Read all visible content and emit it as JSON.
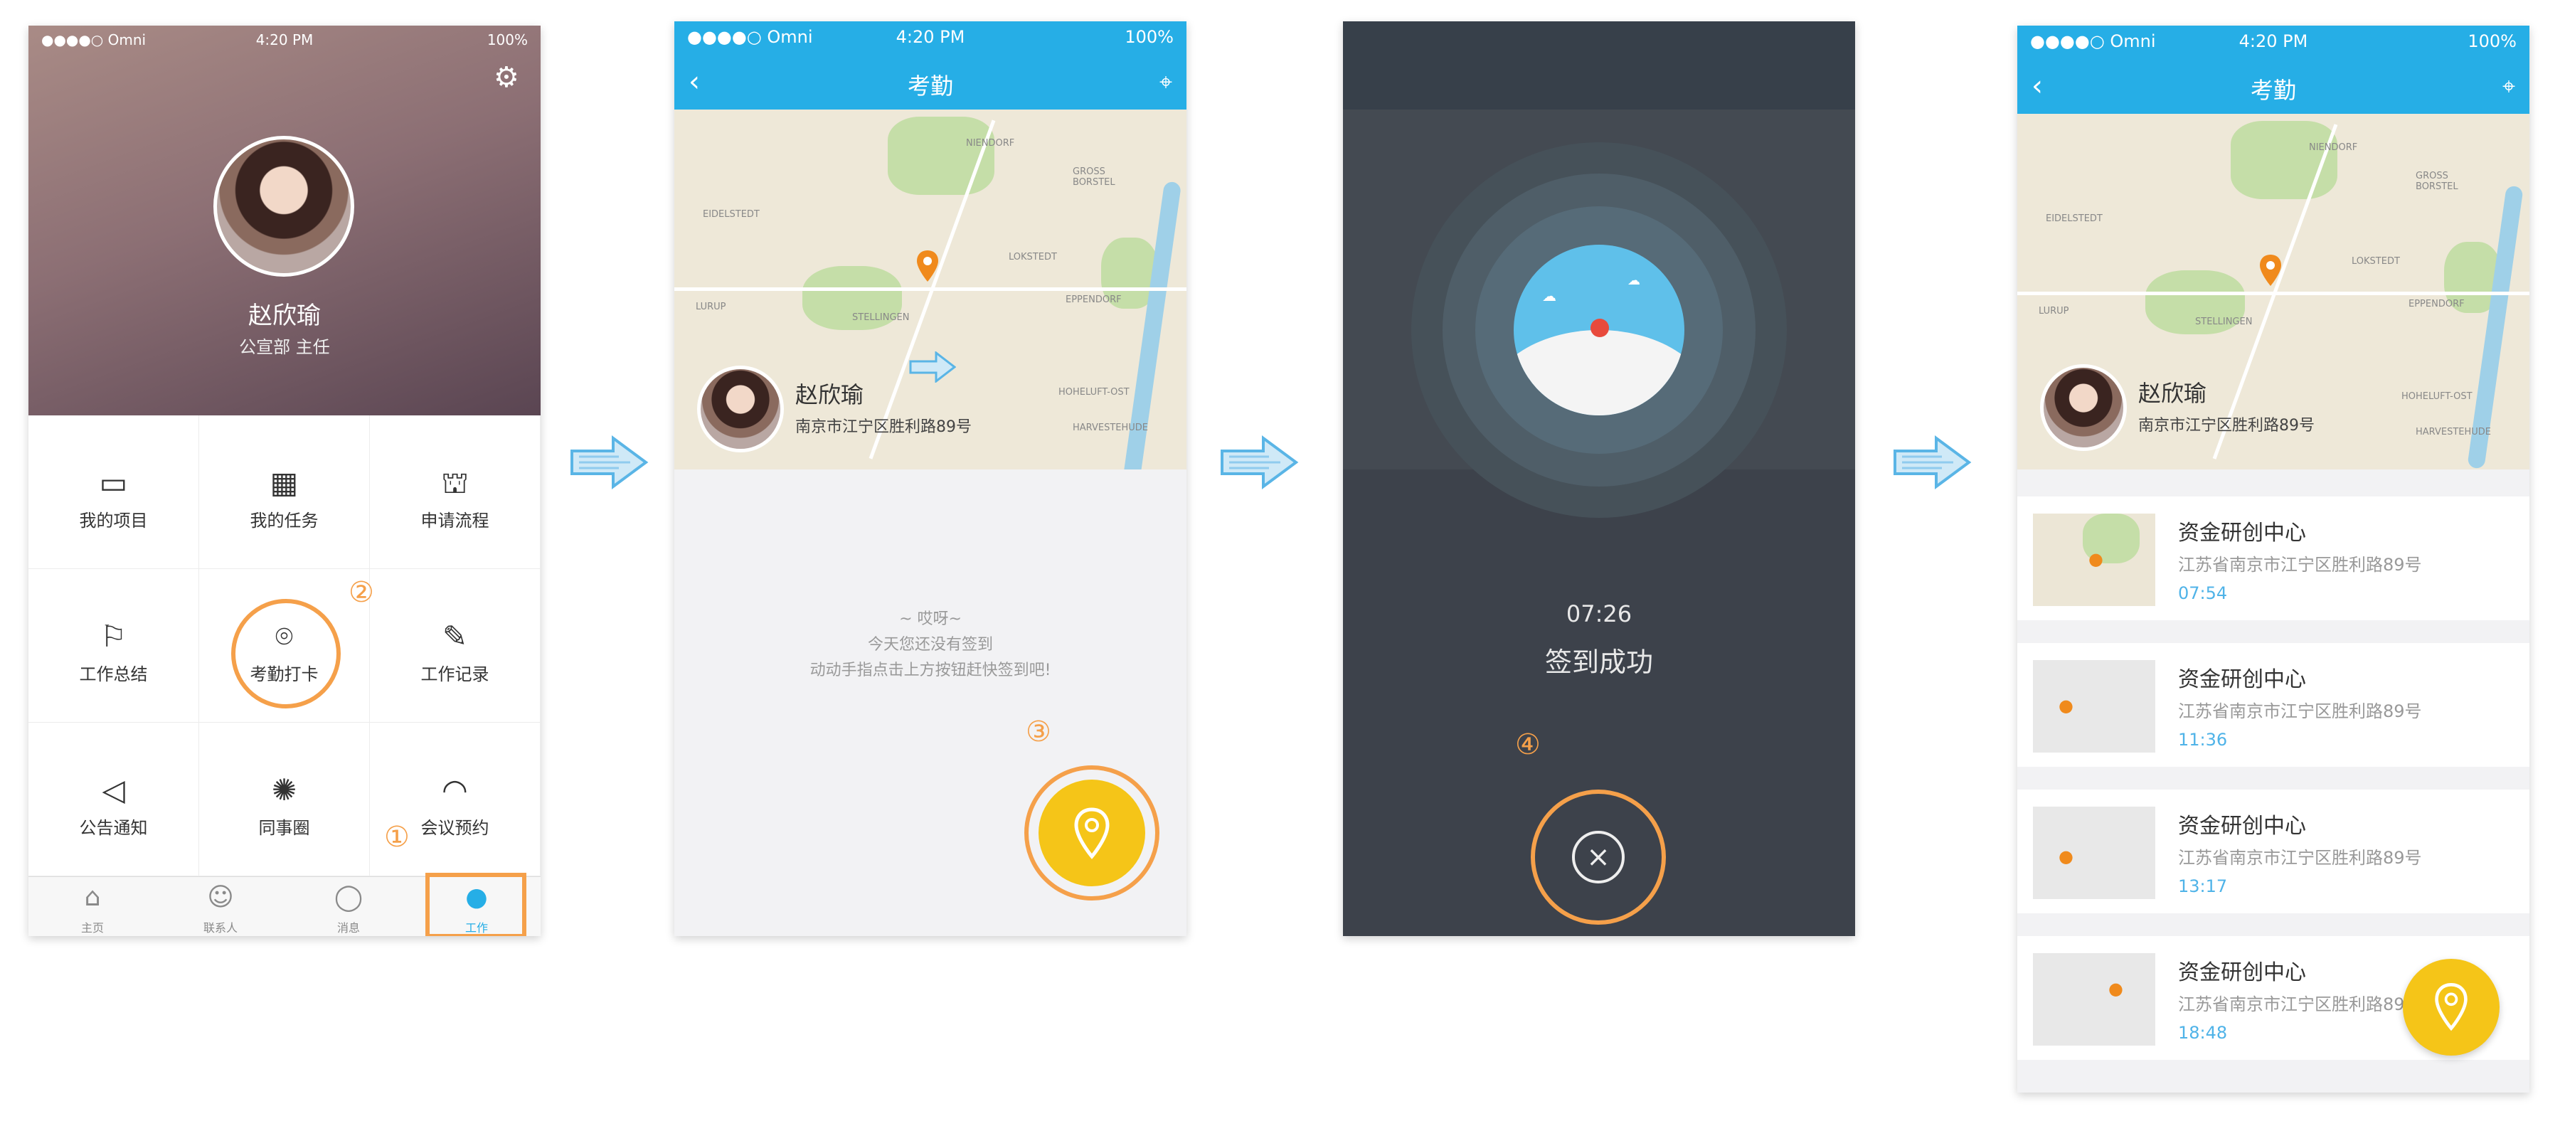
{
  "status": {
    "carrier": "●●●●○ Omni",
    "time": "4:20 PM",
    "battery": "100%"
  },
  "profile": {
    "name": "赵欣瑜",
    "role": "公宣部 主任"
  },
  "grid": [
    {
      "label": "我的项目",
      "icon": "inbox-icon",
      "glyph": "▭"
    },
    {
      "label": "我的任务",
      "icon": "calendar-icon",
      "glyph": "▦"
    },
    {
      "label": "申请流程",
      "icon": "stamp-icon",
      "glyph": "⛫"
    },
    {
      "label": "工作总结",
      "icon": "flag-icon",
      "glyph": "⚐"
    },
    {
      "label": "考勤打卡",
      "icon": "location-pin-icon",
      "glyph": "⌾"
    },
    {
      "label": "工作记录",
      "icon": "pen-icon",
      "glyph": "✎"
    },
    {
      "label": "公告通知",
      "icon": "megaphone-icon",
      "glyph": "◁"
    },
    {
      "label": "同事圈",
      "icon": "aperture-icon",
      "glyph": "✺"
    },
    {
      "label": "会议预约",
      "icon": "meeting-icon",
      "glyph": "◠"
    }
  ],
  "tabs": [
    {
      "label": "主页",
      "icon": "home-icon",
      "glyph": "⌂"
    },
    {
      "label": "联系人",
      "icon": "contacts-icon",
      "glyph": "☺"
    },
    {
      "label": "消息",
      "icon": "chat-icon",
      "glyph": "◯"
    },
    {
      "label": "工作",
      "icon": "person-icon",
      "glyph": "●"
    }
  ],
  "steps": [
    "①",
    "②",
    "③",
    "④"
  ],
  "attendance": {
    "title": "考勤",
    "user_name": "赵欣瑜",
    "user_address": "南京市江宁区胜利路89号",
    "empty_line1": "~ 哎呀~",
    "empty_line2": "今天您还没有签到",
    "empty_line3": "动动手指点击上方按钮赶快签到吧!"
  },
  "success": {
    "time": "07:26",
    "message": "签到成功"
  },
  "records": [
    {
      "title": "资金研创中心",
      "address": "江苏省南京市江宁区胜利路89号",
      "time": "07:54"
    },
    {
      "title": "资金研创中心",
      "address": "江苏省南京市江宁区胜利路89号",
      "time": "11:36"
    },
    {
      "title": "资金研创中心",
      "address": "江苏省南京市江宁区胜利路89号",
      "time": "13:17"
    },
    {
      "title": "资金研创中心",
      "address": "江苏省南京市江宁区胜利路89号",
      "time": "18:48"
    }
  ],
  "map_labels": [
    "NIENDORF",
    "GROSS BORSTEL",
    "EIDELSTEDT",
    "LOKSTEDT",
    "LURUP",
    "STELLINGEN",
    "EPPENDORF",
    "HOHELUFT-OST",
    "HARVESTEHUDE"
  ],
  "colors": {
    "blue": "#26aee6",
    "orange": "#f5a04a",
    "yellow": "#f5c518",
    "dark": "#3d424b"
  }
}
